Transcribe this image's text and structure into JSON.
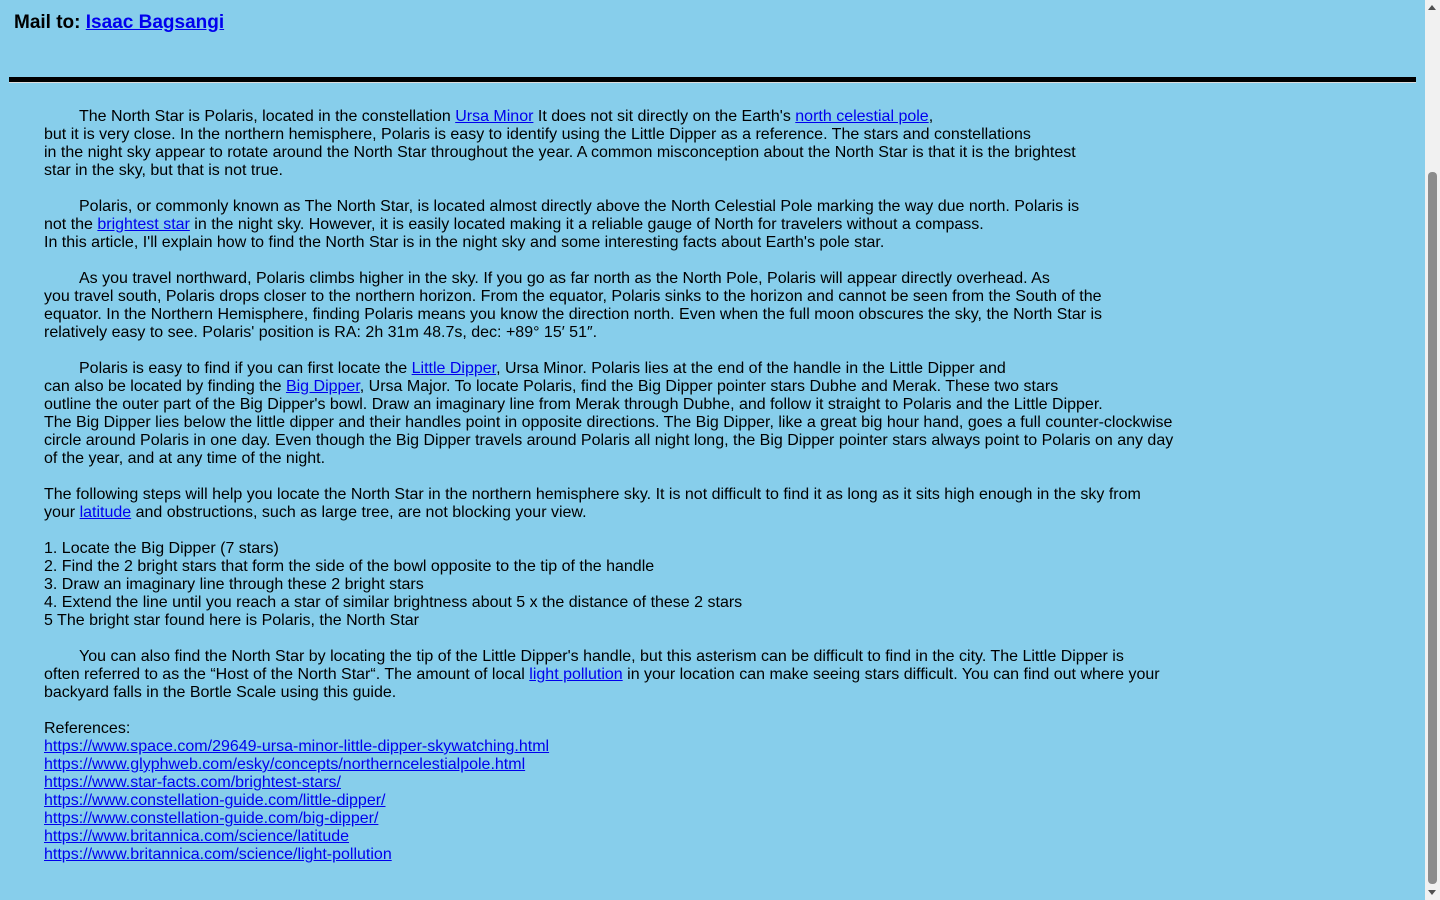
{
  "header": {
    "mail_label": "Mail to:",
    "mail_name": "Isaac Bagsangi"
  },
  "p1": {
    "l1a": "The North Star is Polaris, located in the constellation ",
    "l1_link1": "Ursa Minor",
    "l1b": " It does not sit directly on the Earth's ",
    "l1_link2": "north celestial pole",
    "l1c": ",",
    "l2": "but it is very close. In the northern hemisphere, Polaris is easy to identify using the Little Dipper as a reference. The stars and constellations",
    "l3": "in the night sky appear to rotate around the North Star throughout the year. A common misconception about the North Star is that it is the brightest",
    "l4": "star in the sky, but that is not true."
  },
  "p2": {
    "l1": "Polaris, or commonly known as The North Star, is located almost directly above the North Celestial Pole marking the way due north. Polaris is",
    "l2a": "not the ",
    "l2_link": "brightest star",
    "l2b": " in the night sky. However, it is easily located making it a reliable gauge of North for travelers without a compass.",
    "l3": "In this article, I'll explain how to find the North Star is in the night sky and some interesting facts about Earth's pole star."
  },
  "p3": {
    "l1": "As you travel northward, Polaris climbs higher in the sky. If you go as far north as the North Pole, Polaris will appear directly overhead. As",
    "l2": "you travel south, Polaris drops closer to the northern horizon. From the equator, Polaris sinks to the horizon and cannot be seen from the South of the",
    "l3": "equator. In the Northern Hemisphere, finding Polaris means you know the direction north. Even when the full moon obscures the sky, the North Star is",
    "l4": "relatively easy to see. Polaris' position is RA: 2h 31m 48.7s, dec: +89° 15′ 51″."
  },
  "p4": {
    "l1a": "Polaris is easy to find if you can first locate the ",
    "l1_link": "Little Dipper",
    "l1b": ", Ursa Minor. Polaris lies at the end of the handle in the Little Dipper and",
    "l2a": "can also be located by finding the ",
    "l2_link": "Big Dipper",
    "l2b": ", Ursa Major. To locate Polaris, find the Big Dipper pointer stars Dubhe and Merak. These two stars",
    "l3": "outline the outer part of the Big Dipper's bowl. Draw an imaginary line from Merak through Dubhe, and follow it straight to Polaris and the Little Dipper.",
    "l4": "The Big Dipper lies below the little dipper and their handles point in opposite directions. The Big Dipper, like a great big hour hand, goes a full counter-clockwise",
    "l5": "circle around Polaris in one day. Even though the Big Dipper travels around Polaris all night long, the Big Dipper pointer stars always point to Polaris on any day",
    "l6": "of the year, and at any time of the night."
  },
  "p5": {
    "l1": "The following steps will help you locate the North Star in the northern hemisphere sky. It is not difficult to find it as long as it sits high enough in the sky from",
    "l2a": "your ",
    "l2_link": "latitude",
    "l2b": " and obstructions, such as large tree, are not blocking your view."
  },
  "steps": [
    "1. Locate the Big Dipper (7 stars)",
    "2. Find the 2 bright stars that form the side of the bowl opposite to the tip of the handle",
    "3. Draw an imaginary line through these 2 bright stars",
    "4. Extend the line until you reach a star of similar brightness about 5 x the distance of these 2 stars",
    "5 The bright star found here is Polaris, the North Star"
  ],
  "p6": {
    "l1": "You can also find the North Star by locating the tip of the Little Dipper's handle, but this asterism can be difficult to find in the city. The Little Dipper is",
    "l2a": "often referred to as the “Host of the North Star“. The amount of local ",
    "l2_link": "light pollution",
    "l2b": " in your location can make seeing stars difficult. You can find out where your",
    "l3": "backyard falls in the Bortle Scale using this guide."
  },
  "references": {
    "label": "References:",
    "links": [
      "https://www.space.com/29649-ursa-minor-little-dipper-skywatching.html",
      "https://www.glyphweb.com/esky/concepts/northerncelestialpole.html",
      "https://www.star-facts.com/brightest-stars/",
      "https://www.constellation-guide.com/little-dipper/",
      "https://www.constellation-guide.com/big-dipper/",
      "https://www.britannica.com/science/latitude",
      "https://www.britannica.com/science/light-pollution"
    ]
  },
  "colors": {
    "background": "#87ceeb",
    "link": "#0000ee",
    "rule": "#000000"
  }
}
